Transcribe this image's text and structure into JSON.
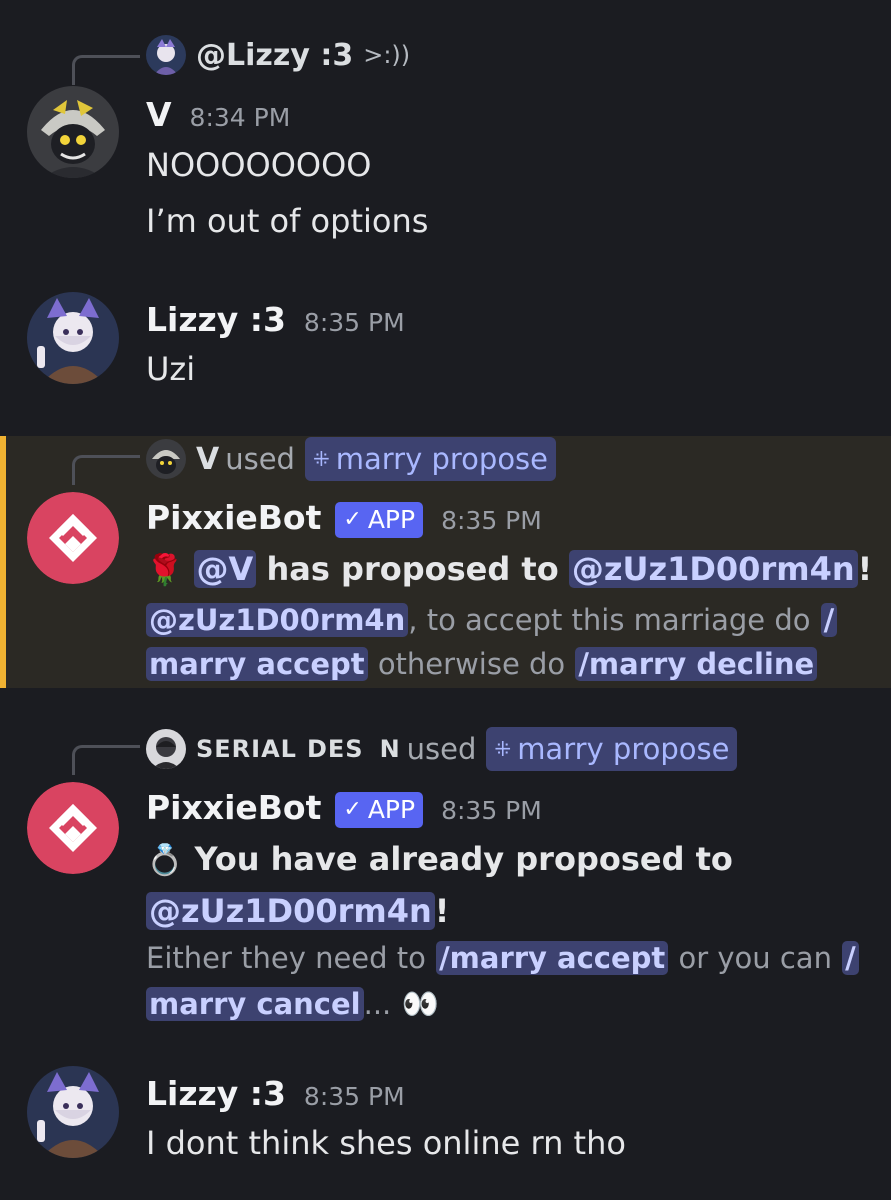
{
  "messages": [
    {
      "reply": {
        "name": "@Lizzy :3",
        "text": ">:))"
      },
      "author": "V",
      "time": "8:34 PM",
      "lines": [
        "NOOOOOOOO",
        "I’m out of options"
      ]
    },
    {
      "author": "Lizzy :3",
      "time": "8:35 PM",
      "lines": [
        "Uzi"
      ]
    },
    {
      "interaction": {
        "user": "V",
        "used": "used",
        "command": "marry propose"
      },
      "author": "PixxieBot",
      "badge": "APP",
      "time": "8:35 PM",
      "emoji": "🌹",
      "mention_v": "@V",
      "proposed_text": "has proposed to",
      "mention_target": "@zUz1D00rm4n",
      "exclaim": "!",
      "line2_mention": "@zUz1D00rm4n",
      "line2_text": ", to accept this marriage do",
      "slash": "/",
      "line3_cmd": "marry accept",
      "line3_text": "otherwise do",
      "line3_cmd2": "/marry decline"
    },
    {
      "interaction": {
        "user_a": "SERIAL",
        "user_b": "DES",
        "user_c": "N",
        "used": "used",
        "command": "marry propose"
      },
      "author": "PixxieBot",
      "badge": "APP",
      "time": "8:35 PM",
      "emoji": "💍",
      "already_text": "You have already proposed to",
      "mention_target": "@zUz1D00rm4n",
      "exclaim": "!",
      "either_text": "Either they need to",
      "cmd_accept": "/marry accept",
      "or_text": "or you can",
      "slash": "/",
      "cmd_cancel": "marry cancel",
      "ellipsis": "...",
      "eyes": "👀"
    },
    {
      "author": "Lizzy :3",
      "time": "8:35 PM",
      "lines": [
        "I dont think shes online rn tho"
      ]
    }
  ],
  "colors": {
    "background": "#1b1c21",
    "highlight_bg": "#2b2924",
    "highlight_border": "#f0b232",
    "mention_bg": "#3d4270",
    "app_badge": "#5865f2",
    "pixxiebot_avatar": "#d94461"
  },
  "icons": {
    "v_avatar": "robot-drone-avatar",
    "lizzy_avatar": "anime-character-avatar",
    "pixxiebot_avatar": "diamond-logo-avatar",
    "command": "slash-command-icon",
    "verified": "checkmark-icon"
  }
}
